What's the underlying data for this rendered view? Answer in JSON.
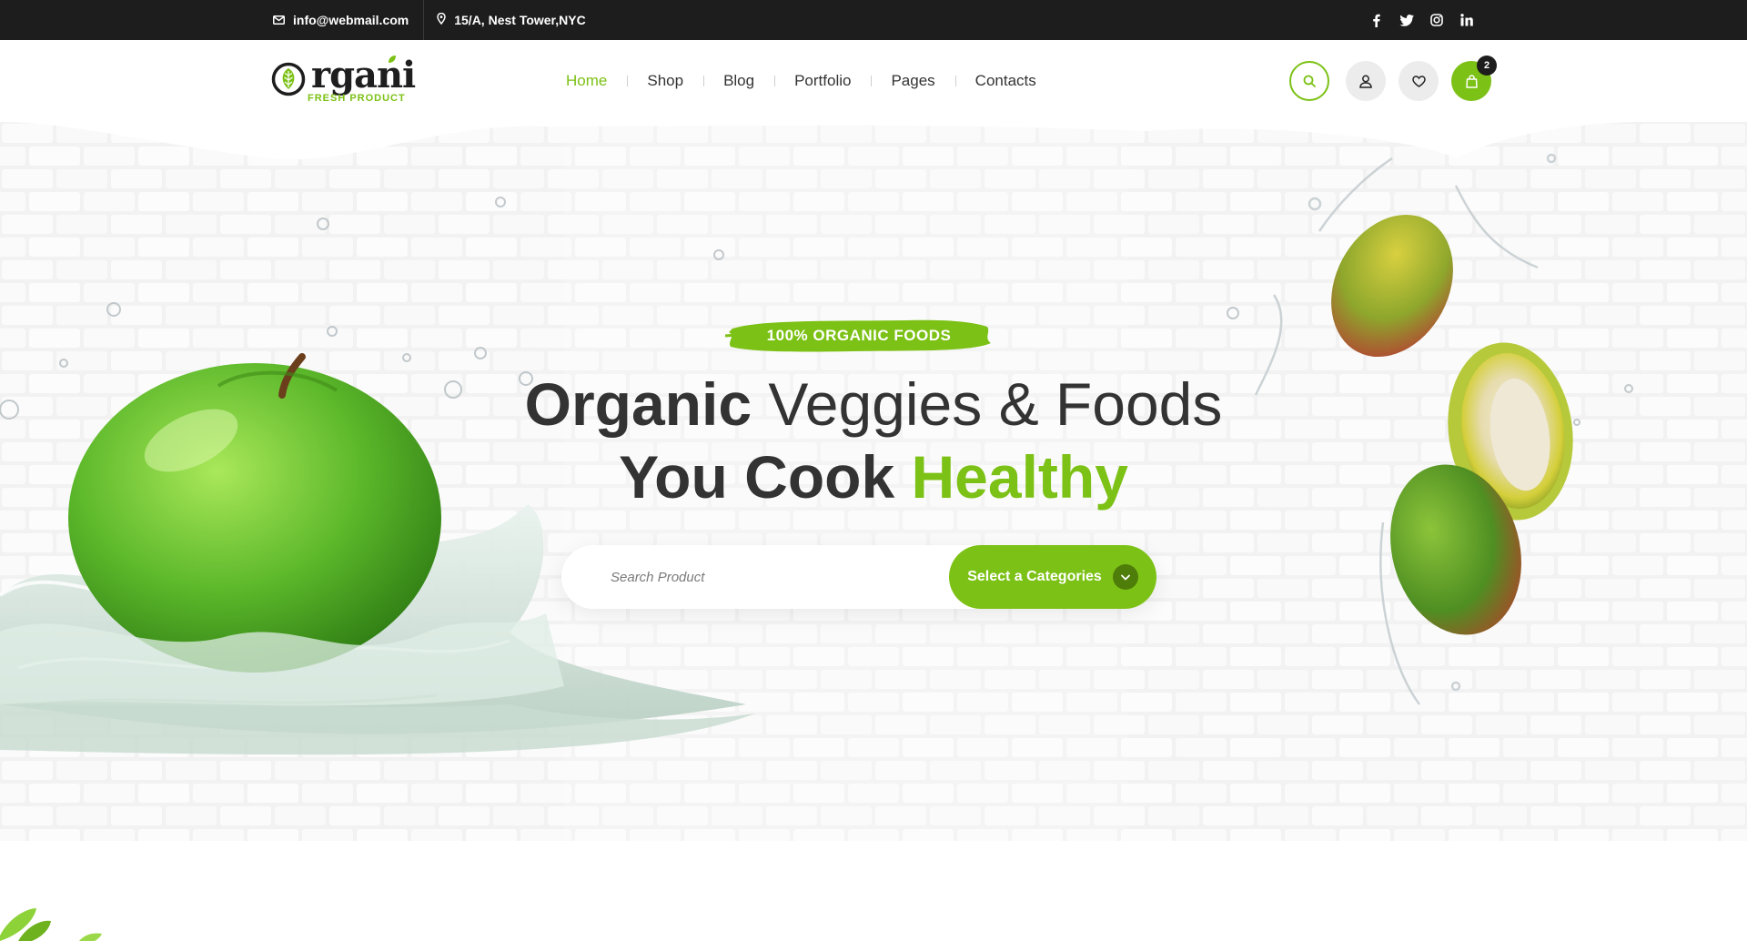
{
  "topbar": {
    "email": "info@webmail.com",
    "address": "15/A, Nest Tower,NYC",
    "icons": [
      "mail-icon",
      "location-pin-icon",
      "facebook-icon",
      "twitter-icon",
      "instagram-icon",
      "linkedin-icon"
    ]
  },
  "header": {
    "logo_word": "rgani",
    "logo_tag": "FRESH PRODUCT",
    "nav": [
      {
        "label": "Home",
        "active": true
      },
      {
        "label": "Shop",
        "active": false
      },
      {
        "label": "Blog",
        "active": false
      },
      {
        "label": "Portfolio",
        "active": false
      },
      {
        "label": "Pages",
        "active": false
      },
      {
        "label": "Contacts",
        "active": false
      }
    ],
    "cart_count": "2",
    "icons": [
      "search-icon",
      "user-icon",
      "heart-icon",
      "shopping-bag-icon"
    ]
  },
  "hero": {
    "badge": "100% ORGANIC FOODS",
    "line1_bold": "Organic",
    "line1_light": " Veggies & Foods",
    "line2_bold": "You Cook ",
    "line2_green": "Healthy",
    "search_placeholder": "Search Product",
    "select_label": "Select a Categories"
  },
  "colors": {
    "accent": "#7cc115",
    "dark": "#1d1d1d",
    "text": "#333333"
  }
}
